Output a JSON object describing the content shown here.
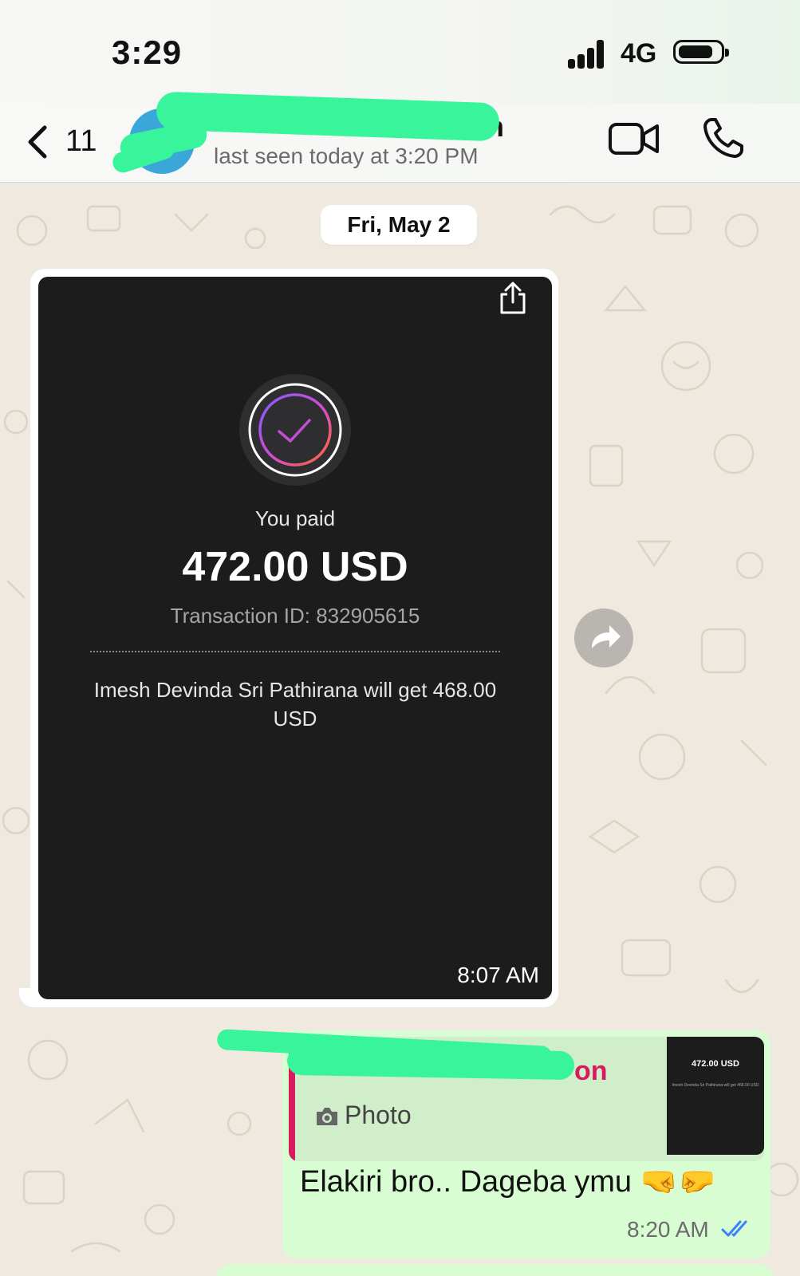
{
  "status_bar": {
    "time": "3:29",
    "network": "4G",
    "battery_icon": "battery-icon",
    "signal_icon": "signal-icon"
  },
  "header": {
    "back_count": "11",
    "contact_name_visible": "on",
    "last_seen": "last seen today at 3:20 PM",
    "icons": [
      "chevron-left-icon",
      "video-camera-icon",
      "phone-icon"
    ]
  },
  "chat": {
    "date_chip": "Fri, May 2",
    "incoming_photo": {
      "you_paid": "You paid",
      "amount": "472.00 USD",
      "transaction": "Transaction ID: 832905615",
      "recipient": "Imesh Devinda Sri Pathirana will get 468.00 USD",
      "time": "8:07 AM"
    },
    "outgoing_message": {
      "quoted_name_visible": "on",
      "quoted_type": "Photo",
      "thumb_amount": "472.00 USD",
      "thumb_recipient": "Imesh Devinda Sri Pathirana will get 468.00 USD",
      "text": "Elakiri bro.. Dageba ymu 🤜🤛",
      "time": "8:20 AM",
      "status": "read"
    }
  },
  "colors": {
    "header_bg": "#f7f7f5",
    "chat_bg": "#efe9df",
    "outgoing": "#d9fdd3",
    "accent_pink": "#d81b60",
    "read_tick": "#3b82f6",
    "redaction": "#38f59b"
  }
}
